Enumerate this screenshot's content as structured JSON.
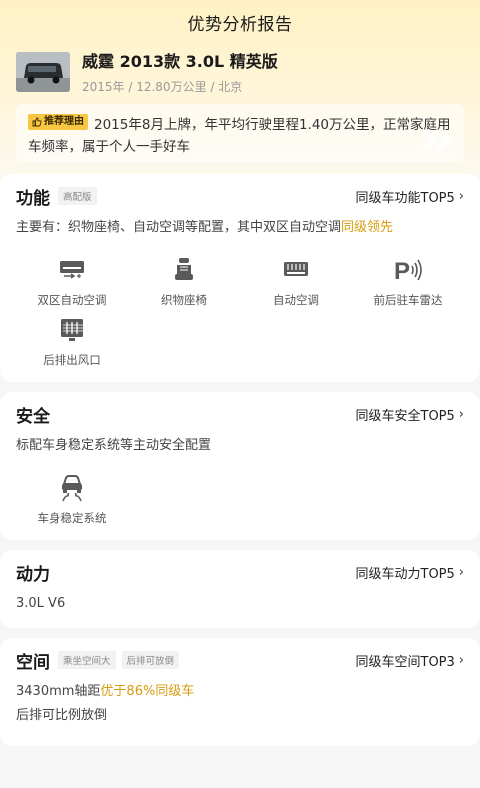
{
  "header": {
    "title": "优势分析报告"
  },
  "car": {
    "title": "威霆 2013款 3.0L 精英版",
    "meta": "2015年 / 12.80万公里 / 北京"
  },
  "reason": {
    "tag": "推荐理由",
    "text": "2015年8月上牌，年平均行驶里程1.40万公里，正常家庭用车频率，属于个人一手好车"
  },
  "function": {
    "title": "功能",
    "chip": "高配版",
    "top_link": "同级车功能TOP5",
    "desc_prefix": "主要有：织物座椅、自动空调等配置，其中双区自动空调",
    "desc_highlight": "同级领先",
    "features": [
      {
        "label": "双区自动空调",
        "icon": "dual-zone-ac-icon"
      },
      {
        "label": "织物座椅",
        "icon": "fabric-seat-icon"
      },
      {
        "label": "自动空调",
        "icon": "auto-ac-icon"
      },
      {
        "label": "前后驻车雷达",
        "icon": "parking-radar-icon"
      },
      {
        "label": "后排出风口",
        "icon": "rear-vent-icon"
      }
    ]
  },
  "safety": {
    "title": "安全",
    "top_link": "同级车安全TOP5",
    "desc": "标配车身稳定系统等主动安全配置",
    "features": [
      {
        "label": "车身稳定系统",
        "icon": "stability-control-icon"
      }
    ]
  },
  "power": {
    "title": "动力",
    "top_link": "同级车动力TOP5",
    "desc": "3.0L V6"
  },
  "space": {
    "title": "空间",
    "chips": [
      "乘坐空间大",
      "后排可放倒"
    ],
    "top_link": "同级车空间TOP3",
    "desc_prefix": "3430mm轴距",
    "desc_highlight": "优于86%同级车",
    "desc2": "后排可比例放倒"
  },
  "colors": {
    "accent": "#d89c0f",
    "tag": "#f7c744"
  }
}
